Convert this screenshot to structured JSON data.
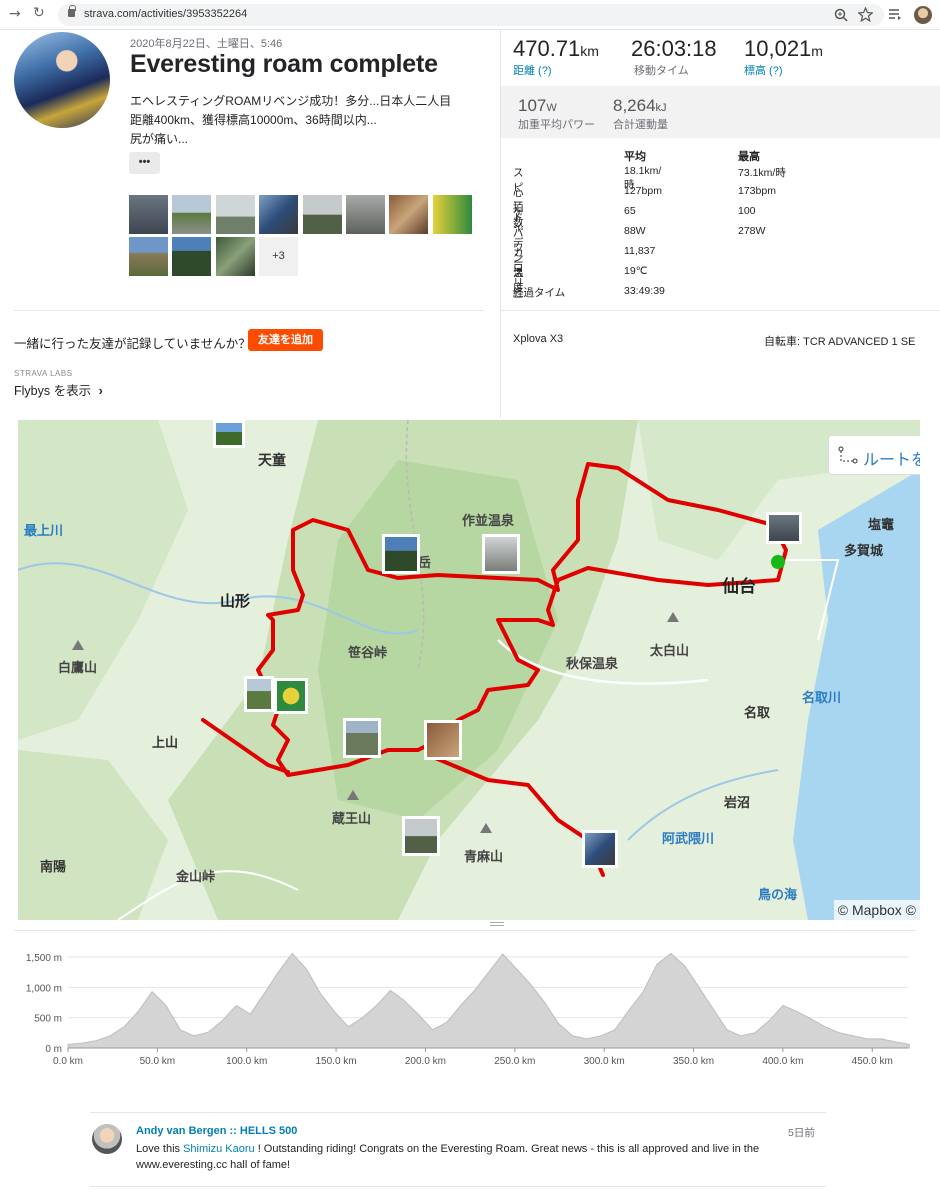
{
  "browser": {
    "url": "strava.com/activities/3953352264",
    "back_icon": "→",
    "reload_icon": "↻"
  },
  "activity": {
    "date": "2020年8月22日、土曜日、5:46",
    "title": "Everesting roam complete",
    "description_lines": [
      "エヘレスティングROAMリベンジ成功！多分...日本人二人目",
      "距離400km、獲得標高10000m、36時間以内...",
      "尻が痛い..."
    ],
    "more_label": "•••",
    "photos_extra": "+3"
  },
  "friends": {
    "prompt": "一緒に行った友達が記録していませんか？",
    "add_button": "友達を追加",
    "labs_label": "STRAVA LABS",
    "flyby_label": "Flybys を表示",
    "flyby_chevron": "›"
  },
  "stats": {
    "primary": [
      {
        "value": "470.71",
        "unit": "km",
        "label": "距離 (?)"
      },
      {
        "value": "26:03:18",
        "unit": "",
        "label": "移動タイム"
      },
      {
        "value": "10,021",
        "unit": "m",
        "label": "標高 (?)"
      }
    ],
    "secondary": [
      {
        "value": "107",
        "unit": "W",
        "label": "加重平均パワー"
      },
      {
        "value": "8,264",
        "unit": "kJ",
        "label": "合計運動量"
      }
    ],
    "table_headers": [
      "平均",
      "最高"
    ],
    "table_rows": [
      {
        "label": "スピード",
        "avg": "18.1km/時",
        "max": "73.1km/時"
      },
      {
        "label": "心拍数",
        "avg": "127bpm",
        "max": "173bpm"
      },
      {
        "label": "ケイデンス",
        "avg": "65",
        "max": "100"
      },
      {
        "label": "パワー",
        "avg": "88W",
        "max": "278W"
      },
      {
        "label": "カロリー",
        "avg": "11,837",
        "max": ""
      },
      {
        "label": "温度",
        "avg": "19℃",
        "max": ""
      },
      {
        "label": "経過タイム",
        "avg": "33:49:39",
        "max": ""
      }
    ],
    "device": "Xplova X3",
    "bike": "自転車: TCR ADVANCED 1 SE"
  },
  "map": {
    "route_button": "ルートを",
    "attribution": "© Mapbox ©",
    "places": [
      "天童",
      "最上川",
      "作並温泉",
      "塩竈",
      "多賀城",
      "仙台",
      "山形",
      "岳",
      "笹谷峠",
      "秋保温泉",
      "太白山",
      "白鷹山",
      "名取",
      "名取川",
      "上山",
      "岩沼",
      "蔵王山",
      "阿武隈川",
      "青麻山",
      "南陽",
      "金山峠",
      "鳥の海"
    ]
  },
  "elevation": {
    "y_ticks": [
      "1,500 m",
      "1,000 m",
      "500 m",
      "0 m"
    ],
    "x_ticks": [
      "0.0 km",
      "50.0 km",
      "100.0 km",
      "150.0 km",
      "200.0 km",
      "250.0 km",
      "300.0 km",
      "350.0 km",
      "400.0 km",
      "450.0 km"
    ],
    "profile_m": [
      60,
      80,
      120,
      200,
      350,
      600,
      930,
      700,
      300,
      200,
      260,
      450,
      700,
      560,
      900,
      1250,
      1560,
      1300,
      900,
      600,
      350,
      500,
      700,
      950,
      780,
      550,
      300,
      420,
      700,
      950,
      1250,
      1550,
      1300,
      1050,
      750,
      400,
      200,
      150,
      200,
      300,
      620,
      920,
      1380,
      1560,
      1350,
      1000,
      650,
      300,
      200,
      250,
      450,
      700,
      600,
      480,
      350,
      250,
      200,
      150,
      150,
      100,
      60
    ]
  },
  "comment": {
    "author": "Andy van Bergen :: HELLS 500",
    "time": "5日前",
    "text_before": "Love this ",
    "mention": "Shimizu Kaoru",
    "text_after": " ! Outstanding riding! Congrats on the Everesting Roam. Great news - this is all approved and live in the www.everesting.cc hall of fame!"
  },
  "colors": {
    "accent": "#fc4c02",
    "link": "#007fb6",
    "route": "#e00000"
  }
}
